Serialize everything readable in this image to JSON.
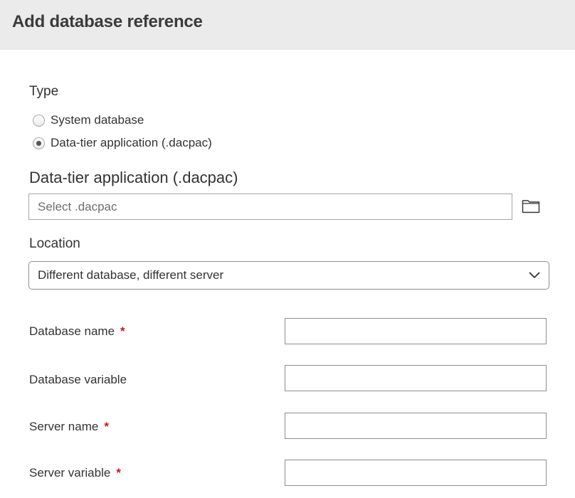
{
  "dialog": {
    "title": "Add database reference"
  },
  "type_section": {
    "label": "Type",
    "options": [
      {
        "label": "System database",
        "checked": false
      },
      {
        "label": "Data-tier application (.dacpac)",
        "checked": true
      }
    ]
  },
  "dacpac": {
    "label": "Data-tier application (.dacpac)",
    "placeholder": "Select .dacpac",
    "value": "",
    "browse_icon": "folder-icon"
  },
  "location": {
    "label": "Location",
    "selected": "Different database, different server"
  },
  "fields": {
    "database_name": {
      "label": "Database name",
      "required_mark": "*",
      "value": ""
    },
    "database_variable": {
      "label": "Database variable",
      "value": ""
    },
    "server_name": {
      "label": "Server name",
      "required_mark": "*",
      "value": ""
    },
    "server_variable": {
      "label": "Server variable",
      "required_mark": "*",
      "value": ""
    }
  },
  "colors": {
    "header_bg": "#ebebeb",
    "required": "#d4111e",
    "border": "#8f8f8f"
  }
}
